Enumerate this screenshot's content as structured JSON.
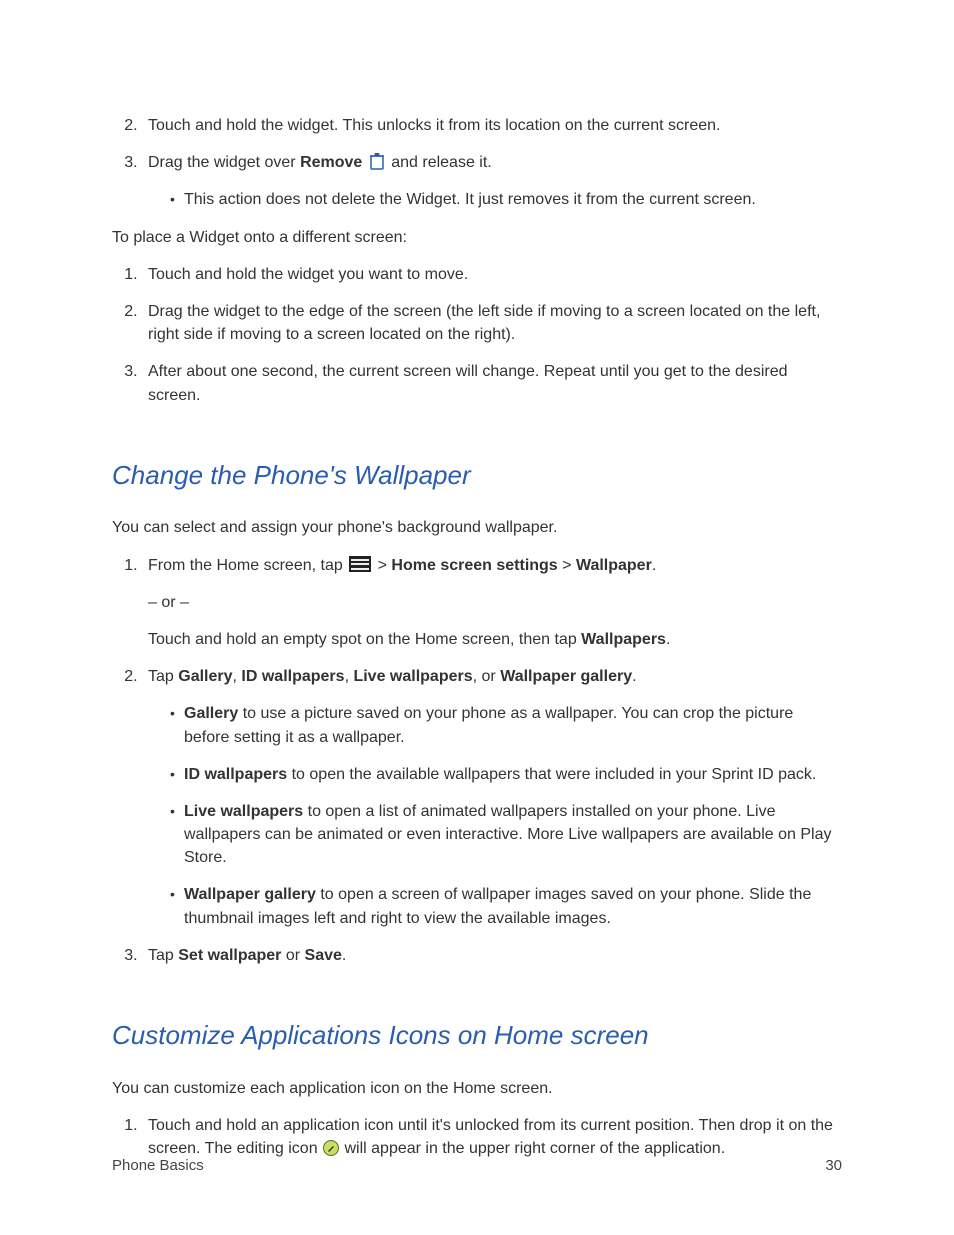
{
  "top_list": {
    "item2": "Touch and hold the widget. This unlocks it from its location on the current screen.",
    "item3_a": "Drag the widget over ",
    "item3_b_bold": "Remove",
    "item3_c": " and release it.",
    "item3_sub": "This action does not delete the Widget. It just removes it from the current screen."
  },
  "place_widget_intro": "To place a Widget onto a different screen:",
  "place_list": {
    "i1": "Touch and hold the widget you want to move.",
    "i2": "Drag the widget to the edge of the screen (the left side if moving to a screen located on the left, right side if moving to a screen located on the right).",
    "i3": "After about one second, the current screen will change. Repeat until you get to the desired screen."
  },
  "wallpaper": {
    "heading": "Change the Phone's Wallpaper",
    "intro": "You can select and assign your phone's background wallpaper.",
    "step1_a": "From the Home screen, tap ",
    "step1_b": " > ",
    "step1_c_bold": "Home screen settings",
    "step1_d": " > ",
    "step1_e_bold": "Wallpaper",
    "step1_f": ".",
    "or": "– or –",
    "step1_alt_a": "Touch and hold an empty spot on the Home screen, then tap ",
    "step1_alt_b_bold": "Wallpapers",
    "step1_alt_c": ".",
    "step2_a": "Tap ",
    "step2_gallery": "Gallery",
    "sep": ", ",
    "step2_id": "ID wallpapers",
    "step2_live": "Live wallpapers",
    "step2_or": ", or ",
    "step2_wg": "Wallpaper gallery",
    "step2_end": ".",
    "sub_gallery_b": "Gallery",
    "sub_gallery_t": " to use a picture saved on your phone as a wallpaper. You can crop the picture before setting it as a wallpaper.",
    "sub_id_b": "ID wallpapers",
    "sub_id_t": " to open the available wallpapers that were included in your Sprint ID pack.",
    "sub_live_b": "Live wallpapers",
    "sub_live_t": " to open a list of animated wallpapers installed on your phone. Live wallpapers can be animated or even interactive. More Live wallpapers are available on Play Store.",
    "sub_wg_b": "Wallpaper gallery",
    "sub_wg_t": " to open a screen of wallpaper images saved on your phone. Slide the thumbnail images left and right to view the available images.",
    "step3_a": "Tap ",
    "step3_b": "Set wallpaper",
    "step3_c": " or ",
    "step3_d": "Save",
    "step3_e": "."
  },
  "customize": {
    "heading": "Customize Applications Icons on Home screen",
    "intro": "You can customize each application icon on the Home screen.",
    "step1_a": "Touch and hold an application icon until it's unlocked from its current position. Then drop it on the screen. The editing icon ",
    "step1_b": " will appear in the upper right corner of the application."
  },
  "footer": {
    "left": "Phone Basics",
    "right": "30"
  }
}
